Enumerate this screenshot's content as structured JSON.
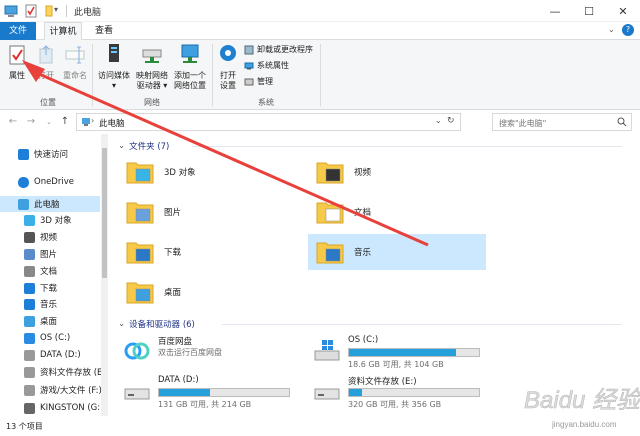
{
  "window": {
    "title": "此电脑",
    "minimize_glyph": "—",
    "maximize_glyph": "☐",
    "close_glyph": "✕"
  },
  "tabs": [
    "文件",
    "计算机",
    "查看"
  ],
  "ribbon": {
    "location": {
      "label": "位置",
      "buttons": [
        "属性",
        "打开",
        "重命名"
      ]
    },
    "network": {
      "label": "网络",
      "buttons": [
        [
          "访问媒体",
          "▾"
        ],
        [
          "映射网络",
          "驱动器 ▾"
        ],
        [
          "添加一个",
          "网络位置"
        ]
      ]
    },
    "system": {
      "label": "系统",
      "open_settings": [
        "打开",
        "设置"
      ],
      "small": [
        "卸载或更改程序",
        "系统属性",
        "管理"
      ]
    }
  },
  "address": {
    "crumb": "此电脑",
    "search_placeholder": "搜索\"此电脑\""
  },
  "sidebar": [
    {
      "label": "快速访问",
      "icon": "star-icon",
      "indent": 0
    },
    {
      "label": "OneDrive",
      "icon": "cloud-icon",
      "indent": 0
    },
    {
      "label": "此电脑",
      "icon": "computer-icon",
      "indent": 0,
      "selected": true
    },
    {
      "label": "3D 对象",
      "icon": "cube-icon",
      "indent": 1
    },
    {
      "label": "视频",
      "icon": "video-icon",
      "indent": 1
    },
    {
      "label": "图片",
      "icon": "picture-icon",
      "indent": 1
    },
    {
      "label": "文档",
      "icon": "document-icon",
      "indent": 1
    },
    {
      "label": "下载",
      "icon": "download-icon",
      "indent": 1
    },
    {
      "label": "音乐",
      "icon": "music-icon",
      "indent": 1
    },
    {
      "label": "桌面",
      "icon": "desktop-icon",
      "indent": 1
    },
    {
      "label": "OS (C:)",
      "icon": "windows-drive-icon",
      "indent": 1
    },
    {
      "label": "DATA (D:)",
      "icon": "drive-icon",
      "indent": 1
    },
    {
      "label": "资料文件存放 (E:)",
      "icon": "drive-icon",
      "indent": 1
    },
    {
      "label": "游戏/大文件 (F:)",
      "icon": "drive-icon",
      "indent": 1
    },
    {
      "label": "KINGSTON (G:)",
      "icon": "usb-drive-icon",
      "indent": 1
    }
  ],
  "folders_section": {
    "title": "文件夹 (7)"
  },
  "folders": [
    {
      "label": "3D 对象",
      "icon": "cube-folder-icon"
    },
    {
      "label": "视频",
      "icon": "video-folder-icon"
    },
    {
      "label": "图片",
      "icon": "picture-folder-icon"
    },
    {
      "label": "文档",
      "icon": "document-folder-icon"
    },
    {
      "label": "下载",
      "icon": "download-folder-icon"
    },
    {
      "label": "音乐",
      "icon": "music-folder-icon",
      "selected": true
    },
    {
      "label": "桌面",
      "icon": "desktop-folder-icon"
    }
  ],
  "devices_section": {
    "title": "设备和驱动器 (6)"
  },
  "devices": [
    {
      "name": "百度网盘",
      "detail": "双击运行百度网盘",
      "icon": "baidu-netdisk-icon"
    },
    {
      "name": "OS (C:)",
      "space": "18.6 GB 可用, 共 104 GB",
      "used_fraction": 0.82,
      "icon": "windows-drive-icon"
    },
    {
      "name": "DATA (D:)",
      "space": "131 GB 可用, 共 214 GB",
      "used_fraction": 0.39,
      "icon": "drive-icon"
    },
    {
      "name": "资料文件存放 (E:)",
      "space": "320 GB 可用, 共 356 GB",
      "used_fraction": 0.1,
      "icon": "drive-icon"
    }
  ],
  "status": {
    "count": "13 个项目"
  },
  "watermark": {
    "text": "Baidu 经验",
    "url": "jingyan.baidu.com"
  },
  "colors": {
    "accent": "#1979ca",
    "selection": "#cce8ff",
    "arrow": "#e8403a",
    "bar": "#26a0da"
  }
}
